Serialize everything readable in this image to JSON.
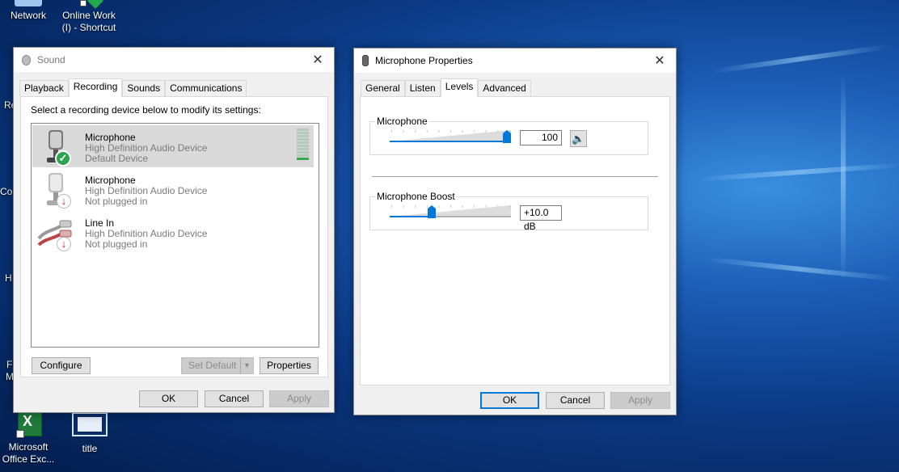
{
  "desktop": {
    "icons": [
      {
        "label": "Network"
      },
      {
        "label": "Online Work (I) - Shortcut"
      },
      {
        "label": "Microsoft Office Exc..."
      },
      {
        "label": "title"
      }
    ],
    "partial_labels": [
      "Re",
      "Co",
      "H",
      "F",
      "M"
    ]
  },
  "sound": {
    "title": "Sound",
    "tabs": [
      "Playback",
      "Recording",
      "Sounds",
      "Communications"
    ],
    "active_tab": "Recording",
    "instruction": "Select a recording device below to modify its settings:",
    "devices": [
      {
        "name": "Microphone",
        "line2": "High Definition Audio Device",
        "line3": "Default Device",
        "status": "default",
        "icon": "microphone-icon",
        "selected": true
      },
      {
        "name": "Microphone",
        "line2": "High Definition Audio Device",
        "line3": "Not plugged in",
        "status": "unplugged",
        "icon": "microphone-icon",
        "selected": false
      },
      {
        "name": "Line In",
        "line2": "High Definition Audio Device",
        "line3": "Not plugged in",
        "status": "unplugged",
        "icon": "line-in-cable-icon",
        "selected": false
      }
    ],
    "buttons": {
      "configure": "Configure",
      "set_default": "Set Default",
      "properties": "Properties",
      "ok": "OK",
      "cancel": "Cancel",
      "apply": "Apply"
    }
  },
  "mic_props": {
    "title": "Microphone Properties",
    "tabs": [
      "General",
      "Listen",
      "Levels",
      "Advanced"
    ],
    "active_tab": "Levels",
    "microphone": {
      "label": "Microphone",
      "value": "100",
      "level": 1.0
    },
    "boost": {
      "label": "Microphone Boost",
      "value": "+10.0 dB",
      "level": 0.333
    },
    "buttons": {
      "ok": "OK",
      "cancel": "Cancel",
      "apply": "Apply"
    }
  },
  "colors": {
    "accent": "#0078d7",
    "ok_green": "#2da44e",
    "unplugged_red": "#d11a1a",
    "meter_green": "#3aa84a"
  }
}
